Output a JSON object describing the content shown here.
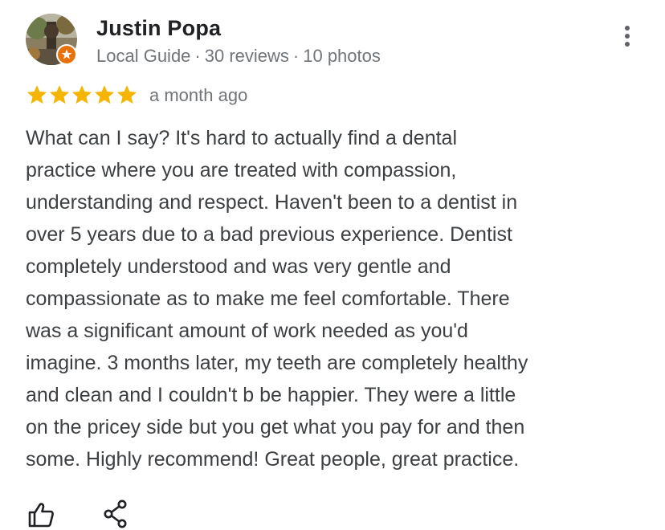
{
  "review": {
    "author_name": "Justin Popa",
    "author_level": "Local Guide",
    "separator": "·",
    "reviews_count": "30 reviews",
    "photos_count": "10 photos",
    "rating": 5,
    "rating_max": 5,
    "date": "a month ago",
    "text": "What can I say? It's hard to actually find a dental\npractice where you are treated with compassion,\nunderstanding and respect. Haven't been to a dentist in\nover 5 years due to a bad previous experience. Dentist\ncompletely understood and was very gentle and\ncompassionate as to make me feel comfortable. There\nwas a significant amount of work needed as you'd\nimagine. 3 months later, my teeth are completely healthy\nand clean and I couldn't b be happier. They were a little\non the pricey side but you get what you pay for and then\nsome. Highly recommend! Great people, great practice."
  },
  "icons": {
    "avatar": "avatar",
    "guide_badge": "local-guide-badge-icon",
    "more": "more-vertical-icon",
    "star": "star-icon",
    "like": "thumbs-up-icon",
    "share": "share-icon"
  },
  "colors": {
    "star": "#f4b400",
    "name": "#202124",
    "meta": "#70757a",
    "text": "#3c4043",
    "badge": "#e8710a"
  }
}
